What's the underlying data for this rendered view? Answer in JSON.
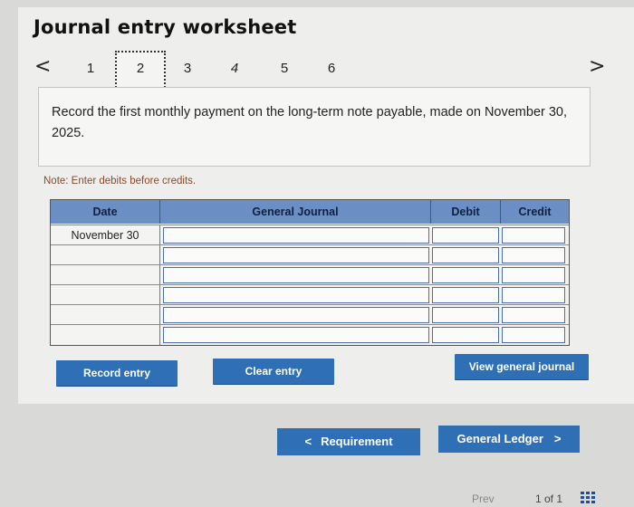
{
  "page": {
    "title": "Journal entry worksheet"
  },
  "steps": {
    "prev_glyph": "<",
    "next_glyph": ">",
    "items": [
      "1",
      "2",
      "3",
      "4",
      "5",
      "6"
    ],
    "active": "2"
  },
  "instructions": {
    "text": "Record the first monthly payment on the long-term note payable, made on November 30, 2025."
  },
  "note": "Note: Enter debits before credits.",
  "journal": {
    "columns": {
      "date": "Date",
      "account": "General Journal",
      "debit": "Debit",
      "credit": "Credit"
    },
    "rows": [
      {
        "date": "November 30",
        "account": "",
        "debit": "",
        "credit": ""
      },
      {
        "date": "",
        "account": "",
        "debit": "",
        "credit": ""
      },
      {
        "date": "",
        "account": "",
        "debit": "",
        "credit": ""
      },
      {
        "date": "",
        "account": "",
        "debit": "",
        "credit": ""
      },
      {
        "date": "",
        "account": "",
        "debit": "",
        "credit": ""
      },
      {
        "date": "",
        "account": "",
        "debit": "",
        "credit": ""
      }
    ]
  },
  "actions": {
    "record": "Record entry",
    "clear": "Clear entry",
    "view": "View general journal"
  },
  "navigation": {
    "requirement": "Requirement",
    "requirement_glyph": "<",
    "ledger": "General Ledger",
    "ledger_glyph": ">"
  },
  "footer": {
    "prev": "Prev",
    "page": "1 of 1"
  },
  "colors": {
    "accent": "#2f6fb5",
    "header": "#6b8fc4",
    "note": "#8a4b2a"
  }
}
